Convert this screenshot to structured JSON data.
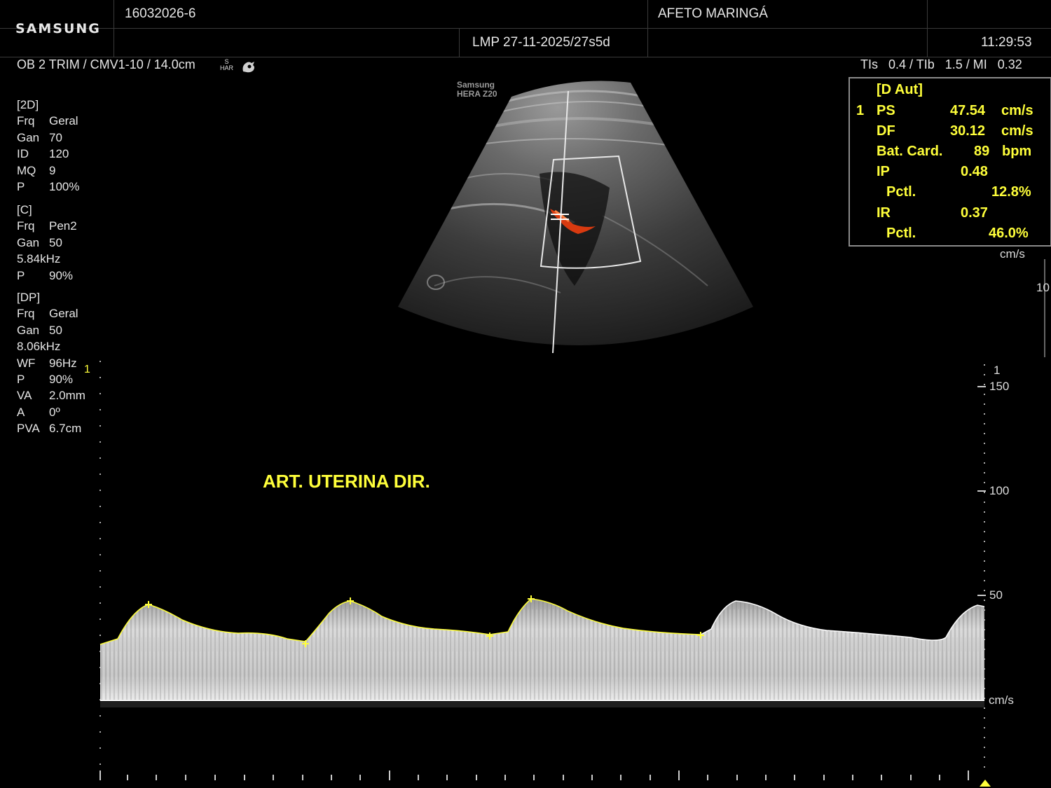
{
  "header": {
    "logo": "SAMSUNG",
    "patient_id": "16032026-6",
    "institution": "AFETO MARINGÁ",
    "lmp": "LMP 27-11-2025/27s5d",
    "time": "11:29:53"
  },
  "subheader": {
    "preset": "OB 2 TRIM / CMV1-10 / 14.0cm",
    "har_top": "S",
    "har_bottom": "HAR",
    "indices": "TIs   0.4 / TIb   1.5 / MI   0.32"
  },
  "probe_label": {
    "line1": "Samsung",
    "line2": "HERA Z20"
  },
  "params_2d": {
    "title": "[2D]",
    "rows": [
      {
        "k": "Frq",
        "v": "Geral"
      },
      {
        "k": "Gan",
        "v": "70"
      },
      {
        "k": "ID",
        "v": "120"
      },
      {
        "k": "MQ",
        "v": "9"
      },
      {
        "k": "P",
        "v": "100%"
      }
    ]
  },
  "params_c": {
    "title": "[C]",
    "rows": [
      {
        "k": "Frq",
        "v": "Pen2"
      },
      {
        "k": "Gan",
        "v": "50"
      },
      {
        "k": "",
        "v": "5.84kHz"
      },
      {
        "k": "P",
        "v": "90%"
      }
    ]
  },
  "params_dp": {
    "title": "[DP]",
    "rows": [
      {
        "k": "Frq",
        "v": "Geral"
      },
      {
        "k": "Gan",
        "v": "50"
      },
      {
        "k": "",
        "v": "8.06kHz"
      },
      {
        "k": "WF",
        "v": "96Hz"
      },
      {
        "k": "P",
        "v": "90%"
      },
      {
        "k": "VA",
        "v": "2.0mm"
      },
      {
        "k": "A",
        "v": "0º"
      },
      {
        "k": "PVA",
        "v": "6.7cm"
      }
    ]
  },
  "measurements": {
    "title": "[D Aut]",
    "index": "1",
    "ps_label": "PS",
    "ps_value": "47.54",
    "ps_unit": "cm/s",
    "df_label": "DF",
    "df_value": "30.12",
    "df_unit": "cm/s",
    "hr_label": "Bat. Card.",
    "hr_value": "89",
    "hr_unit": "bpm",
    "ip_label": "IP",
    "ip_value": "0.48",
    "ip_pctl_label": "Pctl.",
    "ip_pctl_value": "12.8%",
    "ir_label": "IR",
    "ir_value": "0.37",
    "ir_pctl_label": "Pctl.",
    "ir_pctl_value": "46.0%"
  },
  "color_scale": {
    "unit": "cm/s",
    "max": "10"
  },
  "doppler": {
    "annotation": "ART. UTERINA DIR.",
    "marker_left": "1",
    "marker_right": "1",
    "scale_150": "150",
    "scale_100": "100",
    "scale_50": "50",
    "unit": "cm/s"
  },
  "colors": {
    "accent_yellow": "#ffff3a",
    "background": "#000000",
    "doppler_red": "#d83a10"
  }
}
